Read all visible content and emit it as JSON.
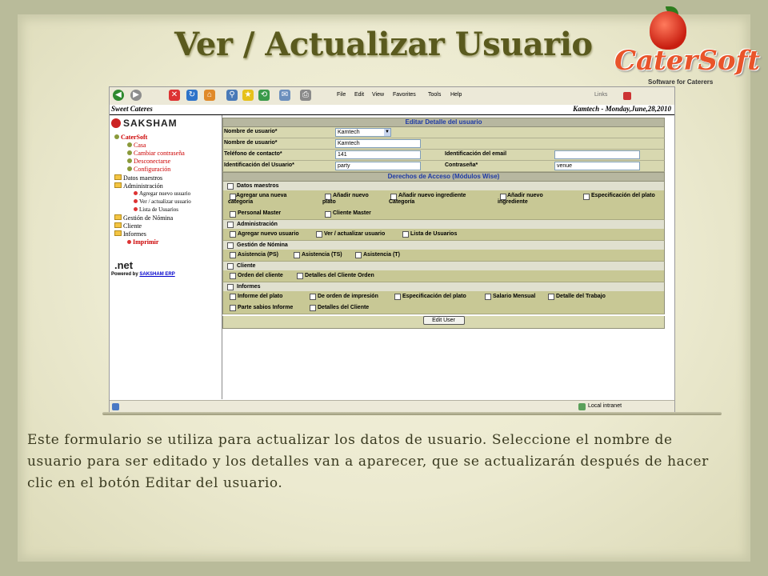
{
  "slide": {
    "title": "Ver / Actualizar Usuario",
    "description": "Este formulario se utiliza para actualizar los datos de usuario. Seleccione el nombre de usuario para ser editado y los detalles van a aparecer, que se actualizarán después de hacer clic en el botón Editar del usuario."
  },
  "logo": {
    "word": "CaterSoft",
    "tagline": "Software for Caterers"
  },
  "browser": {
    "menu": [
      "File",
      "Edit",
      "View",
      "Favorites",
      "Tools",
      "Help"
    ],
    "links_label": "Links",
    "header_left": "Sweet Cateres",
    "header_right": "Kamtech - Monday,June,28,2010",
    "status_zone": "Local intranet"
  },
  "nav": {
    "brand": "SAKSHAM",
    "items": [
      {
        "label": "CaterSoft",
        "style": "red"
      },
      {
        "label": "Casa",
        "style": "red"
      },
      {
        "label": "Cambiar contraseña",
        "style": "red"
      },
      {
        "label": "Desconectarse",
        "style": "red"
      },
      {
        "label": "Configuración",
        "style": "red"
      },
      {
        "label": "Datos maestros",
        "style": "black"
      },
      {
        "label": "Administración",
        "style": "black"
      },
      {
        "label": "Agregar nuevo usuario",
        "style": "black"
      },
      {
        "label": "Ver / actualizar usuario",
        "style": "black"
      },
      {
        "label": "Lista de Usuarios",
        "style": "black"
      },
      {
        "label": "Gestión de Nómina",
        "style": "black"
      },
      {
        "label": "Cliente",
        "style": "black"
      },
      {
        "label": "Informes",
        "style": "black"
      },
      {
        "label": "Imprimir",
        "style": "red"
      }
    ],
    "net_logo": ".net",
    "powered_by": "Powered by",
    "powered_link": "SAKSHAM ERP"
  },
  "form": {
    "header": "Editar Detalle del usuario",
    "username_select_label": "Nombre de usuario*",
    "username_select_value": "Kamtech",
    "username_label": "Nombre de usuario*",
    "username_value": "Kamtech",
    "phone_label": "Teléfono de contacto*",
    "phone_value": "141",
    "email_label": "Identificación del email",
    "email_value": "",
    "userid_label": "Identificación del Usuario*",
    "userid_value": "party",
    "password_label": "Contraseña*",
    "password_value": "venue",
    "access_header": "Derechos de Acceso (Módulos Wise)",
    "sections": {
      "datos": {
        "title": "Datos maestros",
        "options": [
          "Agregar una nueva categoría",
          "Añadir nuevo plato",
          "Añadir nuevo ingrediente Categoría",
          "Añadir nuevo ingrediente",
          "Especificación del plato",
          "Personal Master",
          "Cliente Master"
        ]
      },
      "admin": {
        "title": "Administración",
        "options": [
          "Agregar nuevo usuario",
          "Ver / actualizar usuario",
          "Lista de Usuarios"
        ]
      },
      "nomina": {
        "title": "Gestión de Nómina",
        "options": [
          "Asistencia (PS)",
          "Asistencia (TS)",
          "Asistencia (T)"
        ]
      },
      "cliente": {
        "title": "Cliente",
        "options": [
          "Orden del cliente",
          "Detalles del Cliente Orden"
        ]
      },
      "informes": {
        "title": "Informes",
        "options": [
          "Informe del plato",
          "De orden de impresión",
          "Especificación del plato",
          "Salario Mensual",
          "Detalle del Trabajo",
          "Parte sabios Informe",
          "Detalles del Cliente"
        ]
      }
    },
    "edit_button": "Edit User"
  }
}
